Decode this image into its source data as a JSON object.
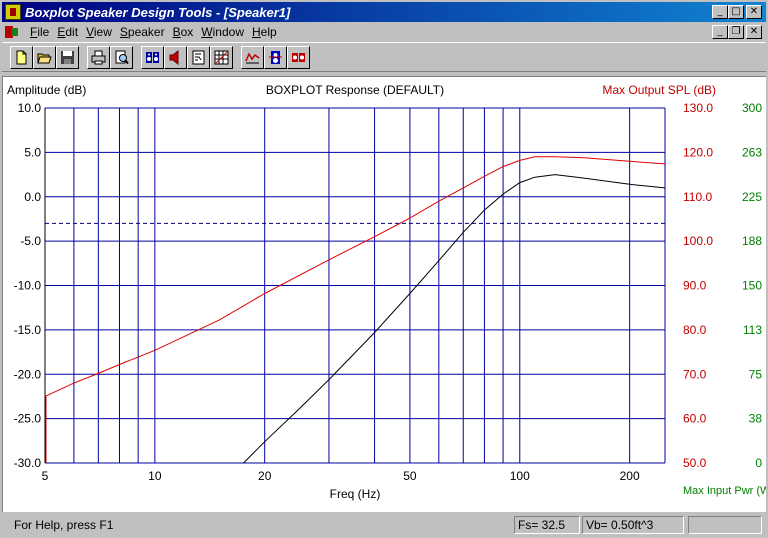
{
  "window": {
    "title": "Boxplot Speaker Design Tools - [Speaker1]"
  },
  "menu": {
    "items": [
      "File",
      "Edit",
      "View",
      "Speaker",
      "Box",
      "Window",
      "Help"
    ],
    "underlined": [
      "F",
      "E",
      "V",
      "S",
      "B",
      "W",
      "H"
    ]
  },
  "toolbar": {
    "buttons": [
      "new-icon",
      "open-icon",
      "save-icon",
      "print-icon",
      "print-preview-icon",
      "speaker-params-icon",
      "speaker-icon",
      "box-icon",
      "table-icon",
      "response-icon",
      "impedance-icon",
      "phase-icon"
    ]
  },
  "chart_data": {
    "type": "line",
    "title": "BOXPLOT Response (DEFAULT)",
    "xlabel": "Freq (Hz)",
    "ylabel": "Amplitude (dB)",
    "ylabel_right": "Max Output SPL (dB)",
    "ylabel_right2": "Max Input Pwr (W",
    "x_scale": "log",
    "xlim": [
      5,
      250
    ],
    "x_tick_labels": [
      "5",
      "10",
      "20",
      "50",
      "100",
      "200"
    ],
    "x_tick_values": [
      5,
      10,
      20,
      50,
      100,
      200
    ],
    "x_minor_values": [
      6,
      7,
      8,
      9,
      30,
      40,
      60,
      70,
      80,
      90
    ],
    "ylim": [
      -30,
      10
    ],
    "y_tick_labels": [
      "10.0",
      "5.0",
      "0.0",
      "-5.0",
      "-10.0",
      "-15.0",
      "-20.0",
      "-25.0",
      "-30.0"
    ],
    "y2_tick_labels": [
      "130.0",
      "120.0",
      "110.0",
      "100.0",
      "90.0",
      "80.0",
      "70.0",
      "60.0",
      "50.0"
    ],
    "y3_tick_labels": [
      "300",
      "263",
      "225",
      "188",
      "150",
      "113",
      "75",
      "38",
      "0"
    ],
    "reference_line": {
      "y": -3,
      "style": "dashed"
    },
    "series": [
      {
        "color": "#000000",
        "x": [
          17.5,
          20,
          25,
          30,
          40,
          50,
          60,
          70,
          80,
          90,
          100,
          110,
          125,
          150,
          200,
          250
        ],
        "y": [
          -30,
          -27.6,
          -23.8,
          -20.6,
          -15.3,
          -10.9,
          -7.2,
          -4.0,
          -1.5,
          0.3,
          1.6,
          2.2,
          2.5,
          2.1,
          1.4,
          1.0
        ]
      },
      {
        "color": "#e00000",
        "x": [
          5,
          6,
          7,
          8,
          10,
          15,
          20,
          30,
          40,
          50,
          60,
          70,
          80,
          90,
          100,
          110,
          125,
          150,
          200,
          250
        ],
        "y": [
          -22.5,
          -21.0,
          -19.9,
          -18.9,
          -17.3,
          -13.9,
          -10.9,
          -7.1,
          -4.5,
          -2.4,
          -0.5,
          1.0,
          2.3,
          3.4,
          4.1,
          4.5,
          4.5,
          4.4,
          4.0,
          3.7
        ]
      }
    ],
    "grid": true,
    "left_edge_red_drop": {
      "x": 5,
      "y_from": -22.5,
      "y_to": -30
    }
  },
  "status": {
    "help": "For Help, press F1",
    "fs": "Fs= 32.5",
    "vb": "Vb= 0.50ft^3",
    "empty": ""
  },
  "colors": {
    "grid": "#0000a0",
    "left_axis_text": "#000000",
    "right_axis_spl": "#c00000",
    "right_axis_pwr": "#008000",
    "spl_line": "#e00000",
    "response_line": "#000000",
    "reference_dash": "#000080"
  }
}
